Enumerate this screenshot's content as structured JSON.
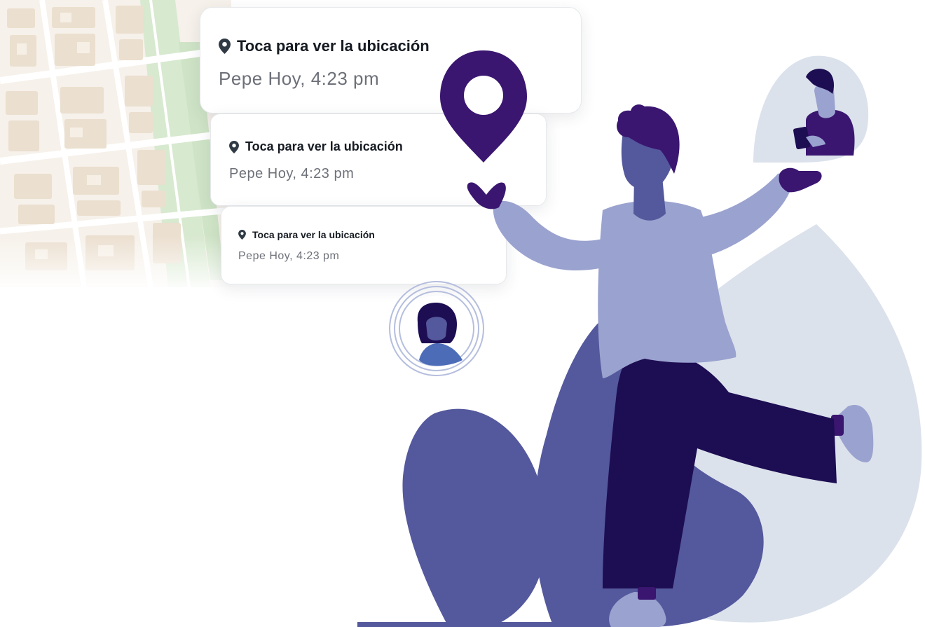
{
  "notifications": [
    {
      "title": "Toca para ver la ubicación",
      "subtitle": "Pepe Hoy, 4:23 pm"
    },
    {
      "title": "Toca para ver la ubicación",
      "subtitle": "Pepe Hoy, 4:23 pm"
    },
    {
      "title": "Toca para ver la ubicación",
      "subtitle": "Pepe Hoy, 4:23 pm"
    }
  ],
  "icons": {
    "card_pin": "location-pin-icon",
    "big_pin": "location-marker-icon"
  },
  "colors": {
    "deep_purple": "#3a1670",
    "navy": "#1d0d52",
    "indigo": "#54589c",
    "lavender": "#9aa2cf",
    "pale_blue_gray": "#dbe2ec",
    "map_block": "#efe5d8",
    "map_green": "#d5e8cf",
    "pin_gray": "#2f3a45"
  }
}
